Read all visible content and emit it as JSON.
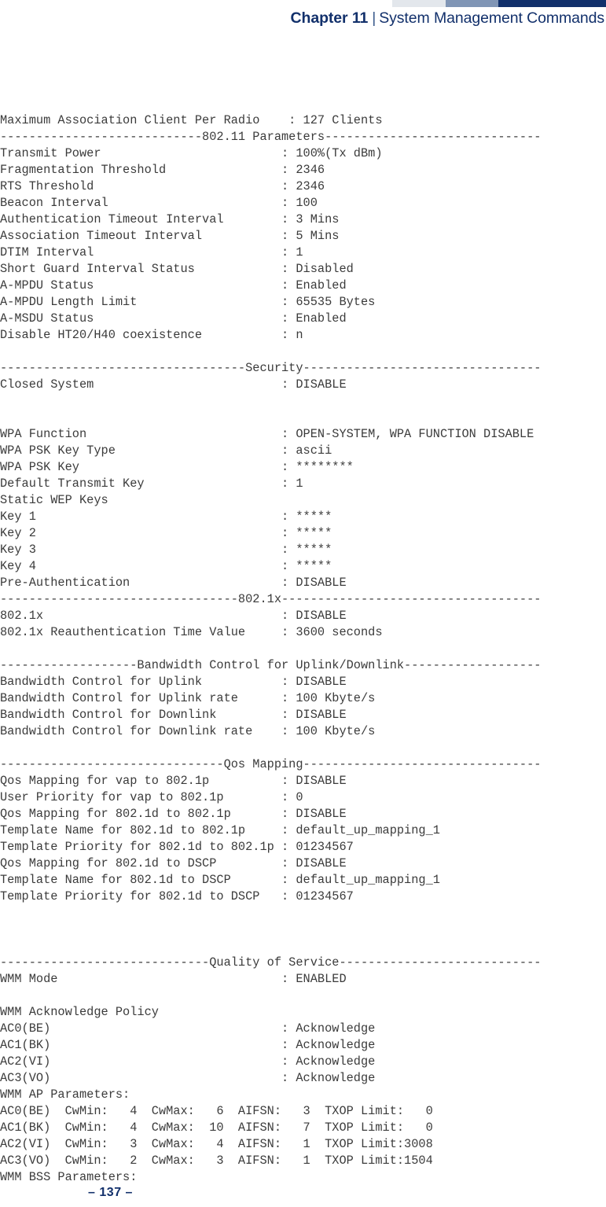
{
  "header": {
    "chapter": "Chapter 11",
    "separator": "|",
    "subject": "System Management Commands",
    "block_colors": [
      "#e3e7ec",
      "#8095b5",
      "#12306b"
    ],
    "text_color": "#12306b"
  },
  "footer": {
    "folio": "–  137  –"
  },
  "console": {
    "font_color": "#3b3b3b",
    "lines": [
      "Maximum Association Client Per Radio    : 127 Clients",
      "----------------------------802.11 Parameters------------------------------",
      "Transmit Power                         : 100%(Tx dBm)",
      "Fragmentation Threshold                : 2346",
      "RTS Threshold                          : 2346",
      "Beacon Interval                        : 100",
      "Authentication Timeout Interval        : 3 Mins",
      "Association Timeout Interval           : 5 Mins",
      "DTIM Interval                          : 1",
      "Short Guard Interval Status            : Disabled",
      "A-MPDU Status                          : Enabled",
      "A-MPDU Length Limit                    : 65535 Bytes",
      "A-MSDU Status                          : Enabled",
      "Disable HT20/H40 coexistence           : n",
      "",
      "----------------------------------Security---------------------------------",
      "Closed System                          : DISABLE",
      "",
      "",
      "WPA Function                           : OPEN-SYSTEM, WPA FUNCTION DISABLE",
      "WPA PSK Key Type                       : ascii",
      "WPA PSK Key                            : ********",
      "Default Transmit Key                   : 1",
      "Static WEP Keys",
      "Key 1                                  : *****",
      "Key 2                                  : *****",
      "Key 3                                  : *****",
      "Key 4                                  : *****",
      "Pre-Authentication                     : DISABLE",
      "---------------------------------802.1x------------------------------------",
      "802.1x                                 : DISABLE",
      "802.1x Reauthentication Time Value     : 3600 seconds",
      "",
      "-------------------Bandwidth Control for Uplink/Downlink-------------------",
      "Bandwidth Control for Uplink           : DISABLE",
      "Bandwidth Control for Uplink rate      : 100 Kbyte/s",
      "Bandwidth Control for Downlink         : DISABLE",
      "Bandwidth Control for Downlink rate    : 100 Kbyte/s",
      "",
      "-------------------------------Qos Mapping---------------------------------",
      "Qos Mapping for vap to 802.1p          : DISABLE",
      "User Priority for vap to 802.1p        : 0",
      "Qos Mapping for 802.1d to 802.1p       : DISABLE",
      "Template Name for 802.1d to 802.1p     : default_up_mapping_1",
      "Template Priority for 802.1d to 802.1p : 01234567",
      "Qos Mapping for 802.1d to DSCP         : DISABLE",
      "Template Name for 802.1d to DSCP       : default_up_mapping_1",
      "Template Priority for 802.1d to DSCP   : 01234567",
      "",
      "",
      "",
      "-----------------------------Quality of Service----------------------------",
      "WMM Mode                               : ENABLED",
      "",
      "WMM Acknowledge Policy",
      "AC0(BE)                                : Acknowledge",
      "AC1(BK)                                : Acknowledge",
      "AC2(VI)                                : Acknowledge",
      "AC3(VO)                                : Acknowledge",
      "WMM AP Parameters:",
      "AC0(BE)  CwMin:   4  CwMax:   6  AIFSN:   3  TXOP Limit:   0",
      "AC1(BK)  CwMin:   4  CwMax:  10  AIFSN:   7  TXOP Limit:   0",
      "AC2(VI)  CwMin:   3  CwMax:   4  AIFSN:   1  TXOP Limit:3008",
      "AC3(VO)  CwMin:   2  CwMax:   3  AIFSN:   1  TXOP Limit:1504",
      "WMM BSS Parameters:"
    ]
  }
}
